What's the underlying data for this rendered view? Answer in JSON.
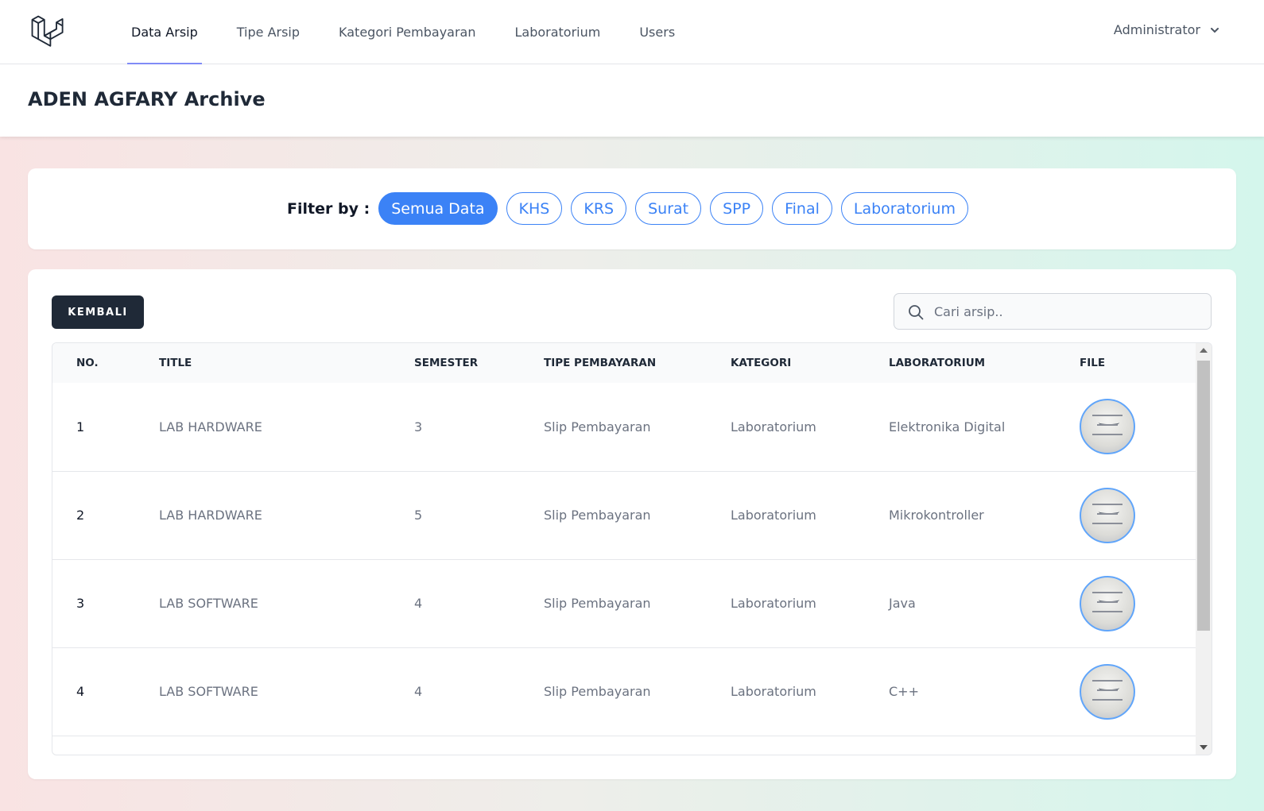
{
  "nav": {
    "items": [
      {
        "label": "Data Arsip",
        "active": true
      },
      {
        "label": "Tipe Arsip"
      },
      {
        "label": "Kategori Pembayaran"
      },
      {
        "label": "Laboratorium"
      },
      {
        "label": "Users"
      }
    ],
    "user": "Administrator"
  },
  "header": {
    "title": "ADEN AGFARY Archive"
  },
  "filter": {
    "label": "Filter by :",
    "options": [
      "Semua Data",
      "KHS",
      "KRS",
      "Surat",
      "SPP",
      "Final",
      "Laboratorium"
    ],
    "selected": "Semua Data"
  },
  "toolbar": {
    "back_label": "KEMBALI",
    "search_placeholder": "Cari arsip.."
  },
  "table": {
    "columns": [
      "NO.",
      "TITLE",
      "SEMESTER",
      "TIPE PEMBAYARAN",
      "KATEGORI",
      "LABORATORIUM",
      "FILE"
    ],
    "rows": [
      {
        "no": "1",
        "title": "LAB HARDWARE",
        "semester": "3",
        "tipe": "Slip Pembayaran",
        "kategori": "Laboratorium",
        "lab": "Elektronika Digital"
      },
      {
        "no": "2",
        "title": "LAB HARDWARE",
        "semester": "5",
        "tipe": "Slip Pembayaran",
        "kategori": "Laboratorium",
        "lab": "Mikrokontroller"
      },
      {
        "no": "3",
        "title": "LAB SOFTWARE",
        "semester": "4",
        "tipe": "Slip Pembayaran",
        "kategori": "Laboratorium",
        "lab": "Java"
      },
      {
        "no": "4",
        "title": "LAB SOFTWARE",
        "semester": "4",
        "tipe": "Slip Pembayaran",
        "kategori": "Laboratorium",
        "lab": "C++"
      }
    ]
  },
  "colors": {
    "accent": "#3b82f6",
    "nav_underline": "#818cf8",
    "dark_button": "#1f2937"
  }
}
